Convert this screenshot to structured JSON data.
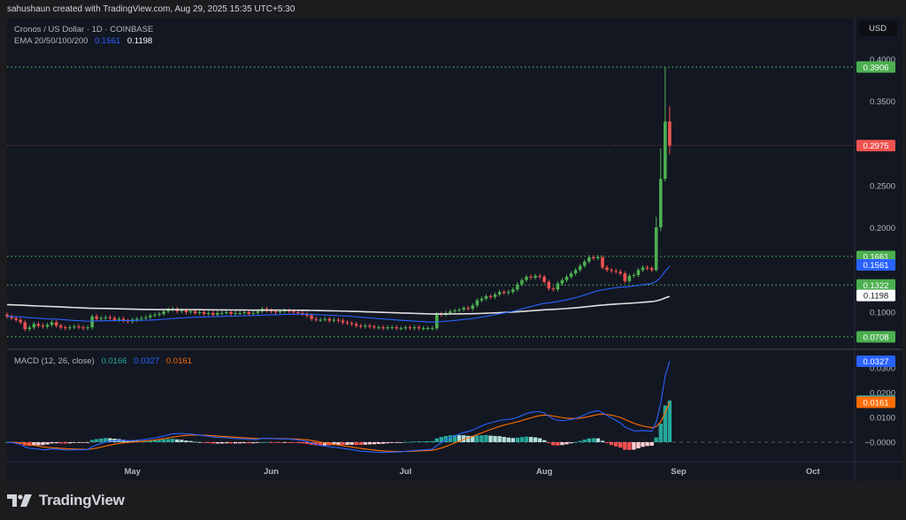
{
  "caption": "sahushaun created with TradingView.com, Aug 29, 2025 15:35 UTC+5:30",
  "legend": {
    "title": "Cronos / US Dollar · 1D · COINBASE",
    "ema_label": "EMA 20/50/100/200",
    "ema_values": [
      "0.1561",
      "0.1198"
    ],
    "macd_label": "MACD (12, 26, close)",
    "macd_values": [
      "0.0166",
      "0.0327",
      "0.0161"
    ]
  },
  "currency_button": "USD",
  "footer": {
    "brand": "TradingView"
  },
  "colors": {
    "up": "#4caf50",
    "down": "#f05350",
    "ema50": "#2962ff",
    "ema200": "#e0e0e0",
    "macd": "#2962ff",
    "signal": "#ff6d00",
    "hist_up_grow": "#26a69a",
    "hist_up_fall": "#b2dfdb",
    "hist_dn_grow": "#ff5252",
    "hist_dn_fall": "#ffcdd2"
  },
  "chart_data": {
    "type": "candlestick",
    "title": "Cronos / US Dollar · 1D · COINBASE",
    "interval": "1D",
    "first_open": 0.097,
    "closes": [
      0.095,
      0.093,
      0.091,
      0.088,
      0.08,
      0.082,
      0.086,
      0.084,
      0.083,
      0.085,
      0.088,
      0.084,
      0.082,
      0.081,
      0.082,
      0.083,
      0.082,
      0.081,
      0.082,
      0.095,
      0.092,
      0.093,
      0.094,
      0.093,
      0.091,
      0.092,
      0.09,
      0.089,
      0.091,
      0.092,
      0.093,
      0.094,
      0.096,
      0.097,
      0.098,
      0.101,
      0.103,
      0.104,
      0.101,
      0.102,
      0.1,
      0.101,
      0.099,
      0.1,
      0.098,
      0.099,
      0.097,
      0.099,
      0.099,
      0.1,
      0.098,
      0.099,
      0.099,
      0.1,
      0.098,
      0.099,
      0.101,
      0.104,
      0.102,
      0.101,
      0.1,
      0.101,
      0.102,
      0.101,
      0.1,
      0.099,
      0.098,
      0.096,
      0.092,
      0.091,
      0.091,
      0.092,
      0.09,
      0.091,
      0.09,
      0.088,
      0.087,
      0.086,
      0.084,
      0.083,
      0.084,
      0.083,
      0.082,
      0.082,
      0.081,
      0.082,
      0.082,
      0.081,
      0.081,
      0.082,
      0.081,
      0.082,
      0.081,
      0.081,
      0.081,
      0.081,
      0.098,
      0.097,
      0.099,
      0.101,
      0.102,
      0.103,
      0.105,
      0.104,
      0.108,
      0.114,
      0.116,
      0.119,
      0.118,
      0.121,
      0.124,
      0.123,
      0.124,
      0.127,
      0.133,
      0.138,
      0.142,
      0.141,
      0.143,
      0.142,
      0.136,
      0.128,
      0.127,
      0.134,
      0.138,
      0.142,
      0.146,
      0.15,
      0.155,
      0.16,
      0.165,
      0.164,
      0.165,
      0.153,
      0.15,
      0.149,
      0.148,
      0.146,
      0.137,
      0.143,
      0.144,
      0.15,
      0.153,
      0.152,
      0.15,
      0.2006,
      0.258,
      0.326,
      0.2975
    ],
    "wick_overrides": [
      {
        "index": 145,
        "high": 0.213,
        "low": 0.148
      },
      {
        "index": 146,
        "high": 0.294,
        "low": 0.196
      },
      {
        "index": 147,
        "high": 0.3906,
        "low": 0.255
      },
      {
        "index": 148,
        "high": 0.344,
        "low": 0.287
      }
    ],
    "ema_seeds": {
      "ema50": 0.095,
      "ema200": 0.109
    },
    "y_axis": {
      "ticks": [
        "0.4000",
        "0.3500",
        "0.2500",
        "0.2000",
        "0.1000"
      ],
      "range": [
        0.06,
        0.41
      ]
    },
    "price_labels": [
      {
        "text": "0.3906",
        "value": 0.3906,
        "bg": "#4caf50",
        "fg": "#ffffff",
        "line": "green"
      },
      {
        "text": "0.2975",
        "value": 0.2975,
        "bg": "#f05350",
        "fg": "#ffffff",
        "line": "red"
      },
      {
        "text": "0.1661",
        "value": 0.1661,
        "bg": "#4caf50",
        "fg": "#ffffff",
        "line": "green"
      },
      {
        "text": "0.1561",
        "value": 0.1561,
        "bg": "#2962ff",
        "fg": "#ffffff",
        "line": "none"
      },
      {
        "text": "0.1322",
        "value": 0.1322,
        "bg": "#4caf50",
        "fg": "#ffffff",
        "line": "green"
      },
      {
        "text": "0.1198",
        "value": 0.1198,
        "bg": "#ffffff",
        "fg": "#131722",
        "line": "none"
      },
      {
        "text": "0.0708",
        "value": 0.0708,
        "bg": "#4caf50",
        "fg": "#ffffff",
        "line": "green"
      }
    ],
    "macd_axis": {
      "ticks": [
        {
          "text": "0.0300",
          "value": 0.03
        },
        {
          "text": "0.0200",
          "value": 0.02
        },
        {
          "text": "0.0100",
          "value": 0.01
        },
        {
          "text": "−0.0000",
          "value": 0
        }
      ]
    },
    "macd_labels": [
      {
        "text": "0.0327",
        "value": 0.0327,
        "bg": "#2962ff"
      },
      {
        "text": "0.0166",
        "value": 0.0166,
        "bg": "#26a69a"
      },
      {
        "text": "0.0161",
        "value": 0.0161,
        "bg": "#ff6d00"
      }
    ],
    "x_ticks": [
      {
        "label": "May",
        "day": 28
      },
      {
        "label": "Jun",
        "day": 59
      },
      {
        "label": "Jul",
        "day": 89
      },
      {
        "label": "Aug",
        "day": 120
      },
      {
        "label": "Sep",
        "day": 150
      },
      {
        "label": "Oct",
        "day": 180
      }
    ]
  }
}
